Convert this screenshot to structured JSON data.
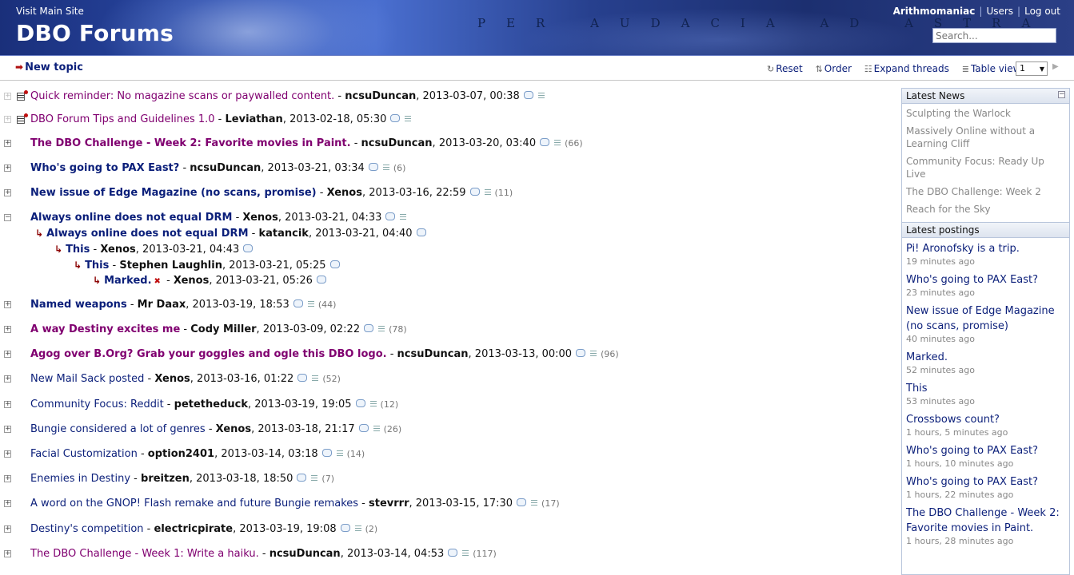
{
  "header": {
    "visit_link": "Visit Main Site",
    "site_title": "DBO Forums",
    "motto": "PER AUDACIA AD ASTRA",
    "username": "Arithmomaniac",
    "users_link": "Users",
    "logout_link": "Log out",
    "search_placeholder": "Search..."
  },
  "toolbar": {
    "new_topic": "New topic",
    "reset": "Reset",
    "order": "Order",
    "expand": "Expand threads",
    "table_view": "Table view",
    "page": "1"
  },
  "threads": [
    {
      "toggle": "+",
      "sticky": true,
      "title": "Quick reminder: No magazine scans or paywalled content.",
      "bold": false,
      "visited": true,
      "author": "ncsuDuncan",
      "date": "2013-03-07, 00:38",
      "count": ""
    },
    {
      "toggle": "+",
      "sticky": true,
      "title": "DBO Forum Tips and Guidelines 1.0",
      "bold": false,
      "visited": true,
      "author": "Leviathan",
      "date": "2013-02-18, 05:30",
      "count": ""
    },
    {
      "toggle": "+",
      "sticky": false,
      "title": "The DBO Challenge - Week 2: Favorite movies in Paint.",
      "bold": true,
      "visited": true,
      "author": "ncsuDuncan",
      "date": "2013-03-20, 03:40",
      "count": "(66)"
    },
    {
      "toggle": "+",
      "sticky": false,
      "title": "Who's going to PAX East?",
      "bold": true,
      "visited": false,
      "author": "ncsuDuncan",
      "date": "2013-03-21, 03:34",
      "count": "(6)"
    },
    {
      "toggle": "+",
      "sticky": false,
      "title": "New issue of Edge Magazine (no scans, promise)",
      "bold": true,
      "visited": false,
      "author": "Xenos",
      "date": "2013-03-16, 22:59",
      "count": "(11)"
    },
    {
      "toggle": "−",
      "sticky": false,
      "title": "Always online does not equal DRM",
      "bold": true,
      "visited": false,
      "author": "Xenos",
      "date": "2013-03-21, 04:33",
      "count": ""
    },
    {
      "toggle": "+",
      "sticky": false,
      "title": "Named weapons",
      "bold": true,
      "visited": false,
      "author": "Mr Daax",
      "date": "2013-03-19, 18:53",
      "count": "(44)"
    },
    {
      "toggle": "+",
      "sticky": false,
      "title": "A way Destiny excites me",
      "bold": true,
      "visited": true,
      "author": "Cody Miller",
      "date": "2013-03-09, 02:22",
      "count": "(78)"
    },
    {
      "toggle": "+",
      "sticky": false,
      "title": "Agog over B.Org? Grab your goggles and ogle this DBO logo.",
      "bold": true,
      "visited": true,
      "author": "ncsuDuncan",
      "date": "2013-03-13, 00:00",
      "count": "(96)"
    },
    {
      "toggle": "+",
      "sticky": false,
      "title": "New Mail Sack posted",
      "bold": false,
      "visited": false,
      "author": "Xenos",
      "date": "2013-03-16, 01:22",
      "count": "(52)"
    },
    {
      "toggle": "+",
      "sticky": false,
      "title": "Community Focus: Reddit",
      "bold": false,
      "visited": false,
      "author": "petetheduck",
      "date": "2013-03-19, 19:05",
      "count": "(12)"
    },
    {
      "toggle": "+",
      "sticky": false,
      "title": "Bungie considered a lot of genres",
      "bold": false,
      "visited": false,
      "author": "Xenos",
      "date": "2013-03-18, 21:17",
      "count": "(26)"
    },
    {
      "toggle": "+",
      "sticky": false,
      "title": "Facial Customization",
      "bold": false,
      "visited": false,
      "author": "option2401",
      "date": "2013-03-14, 03:18",
      "count": "(14)"
    },
    {
      "toggle": "+",
      "sticky": false,
      "title": "Enemies in Destiny",
      "bold": false,
      "visited": false,
      "author": "breitzen",
      "date": "2013-03-18, 18:50",
      "count": "(7)"
    },
    {
      "toggle": "+",
      "sticky": false,
      "title": "A word on the GNOP! Flash remake and future Bungie remakes",
      "bold": false,
      "visited": false,
      "author": "stevrrr",
      "date": "2013-03-15, 17:30",
      "count": "(17)"
    },
    {
      "toggle": "+",
      "sticky": false,
      "title": "Destiny's competition",
      "bold": false,
      "visited": false,
      "author": "electricpirate",
      "date": "2013-03-19, 19:08",
      "count": "(2)"
    },
    {
      "toggle": "+",
      "sticky": false,
      "title": "The DBO Challenge - Week 1: Write a haiku.",
      "bold": false,
      "visited": true,
      "author": "ncsuDuncan",
      "date": "2013-03-14, 04:53",
      "count": "(117)"
    }
  ],
  "replies": [
    {
      "title": "Always online does not equal DRM",
      "author": "katancik",
      "date": "2013-03-21, 04:40",
      "deleted": false
    },
    {
      "title": "This",
      "author": "Xenos",
      "date": "2013-03-21, 04:43",
      "deleted": false
    },
    {
      "title": "This",
      "author": "Stephen Laughlin",
      "date": "2013-03-21, 05:25",
      "deleted": false
    },
    {
      "title": "Marked.",
      "author": "Xenos",
      "date": "2013-03-21, 05:26",
      "deleted": true
    }
  ],
  "latest_news": {
    "heading": "Latest News",
    "items": [
      "Sculpting the Warlock",
      "Massively Online without a Learning Cliff",
      "Community Focus: Ready Up Live",
      "The DBO Challenge: Week 2",
      "Reach for the Sky"
    ]
  },
  "latest_postings": {
    "heading": "Latest postings",
    "items": [
      {
        "title": "Pi! Aronofsky is a trip.",
        "ago": "19 minutes ago"
      },
      {
        "title": "Who's going to PAX East?",
        "ago": "23 minutes ago"
      },
      {
        "title": "New issue of Edge Magazine (no scans, promise)",
        "ago": "40 minutes ago"
      },
      {
        "title": "Marked.",
        "ago": "52 minutes ago"
      },
      {
        "title": "This",
        "ago": "53 minutes ago"
      },
      {
        "title": "Crossbows count?",
        "ago": "1 hours, 5 minutes ago"
      },
      {
        "title": "Who's going to PAX East?",
        "ago": "1 hours, 10 minutes ago"
      },
      {
        "title": "Who's going to PAX East?",
        "ago": "1 hours, 22 minutes ago"
      },
      {
        "title": "The DBO Challenge - Week 2: Favorite movies in Paint.",
        "ago": "1 hours, 28 minutes ago"
      }
    ]
  },
  "colors": {
    "unread_link": "#0b1f7a",
    "visited_link": "#800070",
    "reply_arrow": "#8b0000",
    "header_bg": "#2a4aa8"
  }
}
